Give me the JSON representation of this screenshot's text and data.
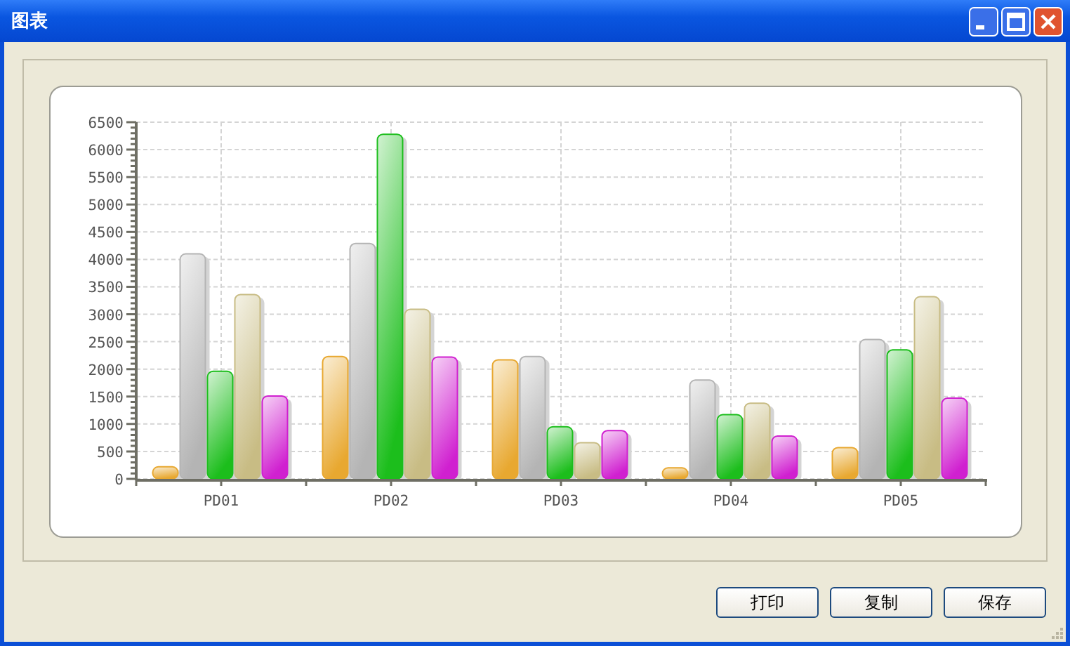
{
  "window": {
    "title": "图表"
  },
  "chart": {
    "chart_data": {
      "type": "bar",
      "grid": true,
      "categories": [
        "PD01",
        "PD02",
        "PD03",
        "PD04",
        "PD05"
      ],
      "ylim": [
        0,
        6500
      ],
      "yticks": [
        0,
        500,
        1000,
        1500,
        2000,
        2500,
        3000,
        3500,
        4000,
        4500,
        5000,
        5500,
        6000,
        6500
      ],
      "series": [
        {
          "color": "#e8a830",
          "values": [
            220,
            2230,
            2170,
            200,
            570
          ]
        },
        {
          "color": "#b4b4b4",
          "values": [
            4100,
            4290,
            2230,
            1800,
            2540
          ]
        },
        {
          "color": "#1cbe1c",
          "values": [
            1960,
            6280,
            950,
            1170,
            2350
          ]
        },
        {
          "color": "#c8bc84",
          "values": [
            3360,
            3090,
            660,
            1380,
            3320
          ]
        },
        {
          "color": "#d020d0",
          "values": [
            1510,
            2220,
            880,
            780,
            1470
          ]
        }
      ]
    }
  },
  "buttons": [
    {
      "label": "打印"
    },
    {
      "label": "复制"
    },
    {
      "label": "保存"
    }
  ]
}
